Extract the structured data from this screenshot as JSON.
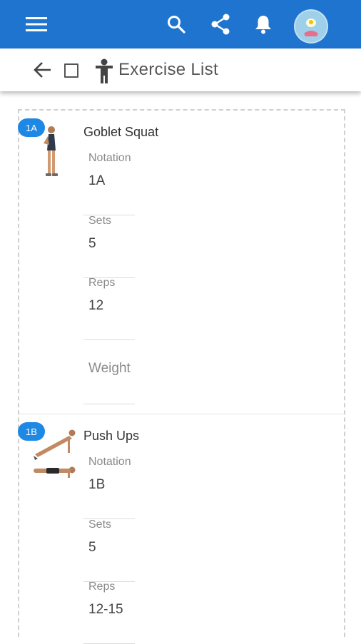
{
  "appbar": {
    "icons": [
      "menu-icon",
      "search-icon",
      "share-icon",
      "bell-icon"
    ],
    "color": "#1f74cf"
  },
  "toolbar": {
    "title": "Exercise List"
  },
  "exercises": [
    {
      "badge": "1A",
      "name": "Goblet Squat",
      "fields": {
        "notation_label": "Notation",
        "notation_value": "1A",
        "sets_label": "Sets",
        "sets_value": "5",
        "reps_label": "Reps",
        "reps_value": "12",
        "weight_label": "Weight"
      }
    },
    {
      "badge": "1B",
      "name": "Push Ups",
      "fields": {
        "notation_label": "Notation",
        "notation_value": "1B",
        "sets_label": "Sets",
        "sets_value": "5",
        "reps_label": "Reps",
        "reps_value": "12-15"
      }
    }
  ],
  "colors": {
    "accent": "#1e88e5"
  }
}
